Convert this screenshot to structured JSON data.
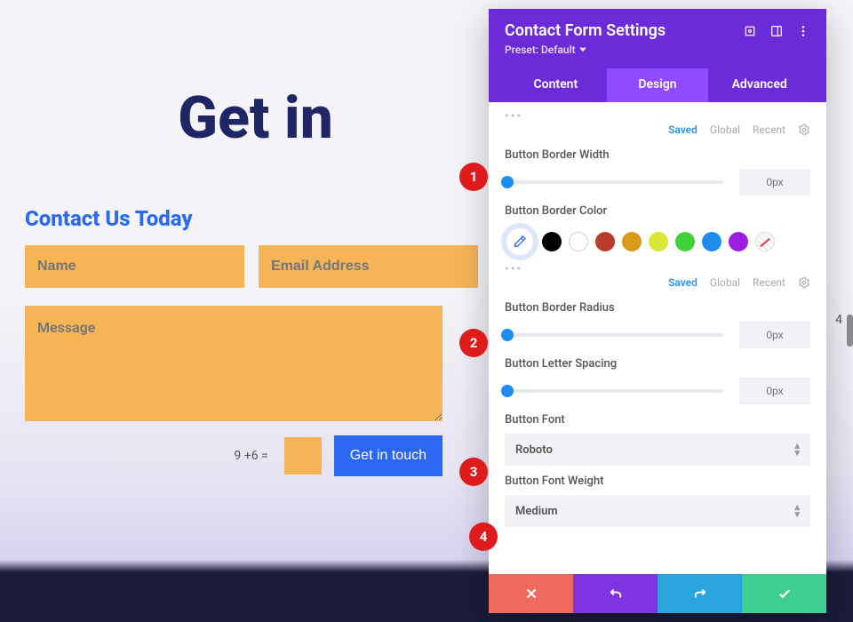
{
  "page": {
    "title": "Get in",
    "contact_heading": "Contact Us Today",
    "form": {
      "name_placeholder": "Name",
      "email_placeholder": "Email Address",
      "message_placeholder": "Message",
      "captcha_q": "9 +6 =",
      "submit_label": "Get in touch"
    }
  },
  "panel": {
    "title": "Contact Form Settings",
    "preset_label": "Preset: Default",
    "tabs": {
      "content": "Content",
      "design": "Design",
      "advanced": "Advanced",
      "active": "design"
    },
    "tag_saved": "Saved",
    "tag_global": "Global",
    "tag_recent": "Recent",
    "options": {
      "border_width": {
        "label": "Button Border Width",
        "value": "0px"
      },
      "border_color": {
        "label": "Button Border Color"
      },
      "border_radius": {
        "label": "Button Border Radius",
        "value": "0px"
      },
      "letter_spacing": {
        "label": "Button Letter Spacing",
        "value": "0px"
      },
      "font": {
        "label": "Button Font",
        "value": "Roboto"
      },
      "font_weight": {
        "label": "Button Font Weight",
        "value": "Medium"
      }
    },
    "swatches": [
      "#000000",
      "#ffffff",
      "#b83d2a",
      "#d99a1b",
      "#d9e635",
      "#42d23c",
      "#1f8cf0",
      "#9b1fe3"
    ]
  },
  "callouts": {
    "c1": "1",
    "c2": "2",
    "c3": "3",
    "c4": "4"
  },
  "floating4": "4"
}
